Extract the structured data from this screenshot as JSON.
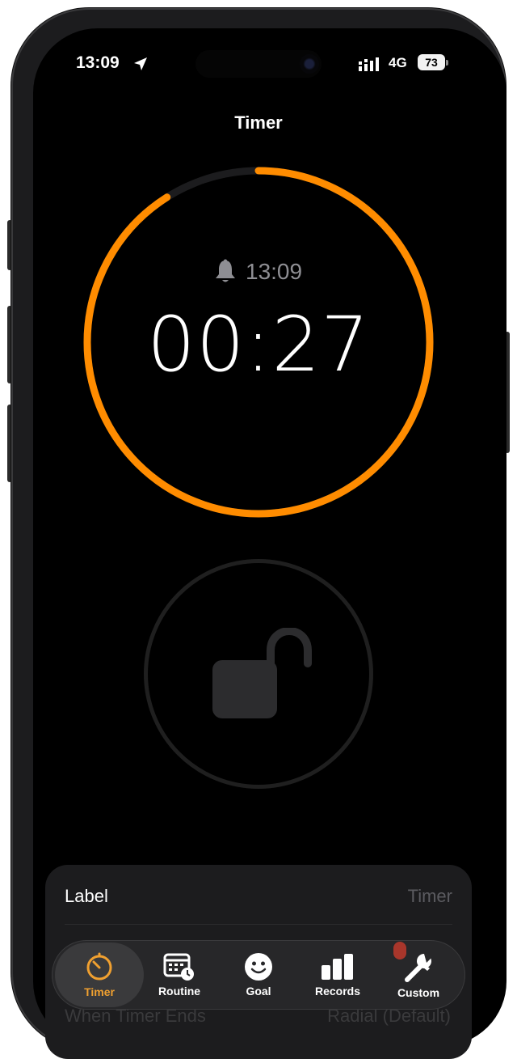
{
  "status": {
    "time": "13:09",
    "network": "4G",
    "battery": "73"
  },
  "header": {
    "title": "Timer"
  },
  "timer": {
    "alarm_time": "13:09",
    "remaining": "00:27",
    "progress_fraction": 0.91,
    "accent_color": "#ff8c00",
    "track_color": "#1c1c1e"
  },
  "lock": {
    "icon": "unlock-icon"
  },
  "settings": {
    "label_row": {
      "label": "Label",
      "value": "Timer"
    },
    "end_row": {
      "label": "When Timer Ends",
      "value": "Radial (Default)"
    }
  },
  "tabs": [
    {
      "label": "Timer",
      "icon": "timer-icon",
      "active": true
    },
    {
      "label": "Routine",
      "icon": "calendar-clock-icon",
      "active": false
    },
    {
      "label": "Goal",
      "icon": "smiley-icon",
      "active": false
    },
    {
      "label": "Records",
      "icon": "bar-chart-icon",
      "active": false
    },
    {
      "label": "Custom",
      "icon": "wrench-icon",
      "active": false
    }
  ]
}
